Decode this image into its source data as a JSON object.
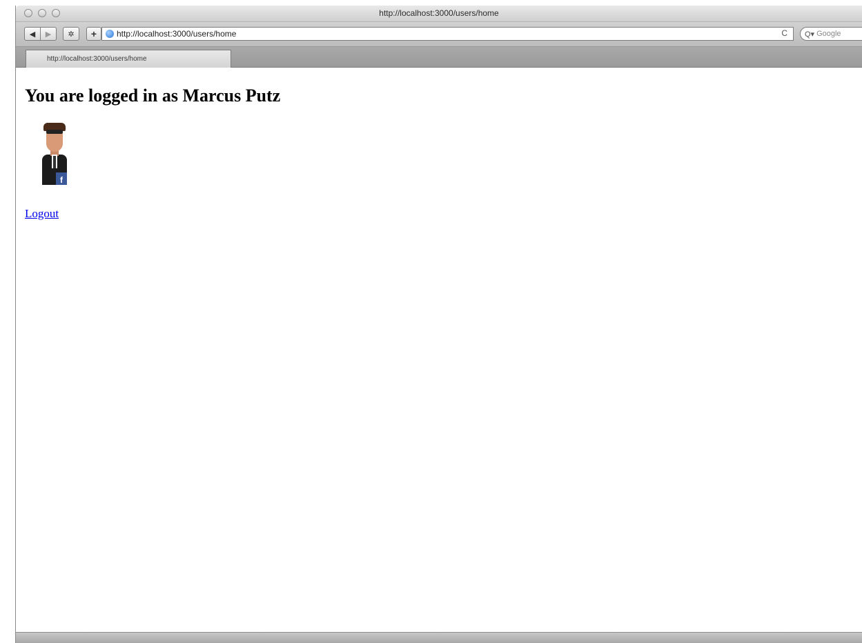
{
  "window": {
    "title": "http://localhost:3000/users/home"
  },
  "toolbar": {
    "back_icon": "◀",
    "forward_icon": "▶",
    "gear_icon": "✲",
    "add_icon": "+",
    "address": "http://localhost:3000/users/home",
    "reload_icon": "C",
    "search_glyph": "Q▾",
    "search_placeholder": "Google"
  },
  "tabs": [
    {
      "label": "http://localhost:3000/users/home"
    }
  ],
  "page": {
    "heading": "You are logged in as Marcus Putz",
    "avatar_badge": "f",
    "logout_label": "Logout"
  },
  "colors": {
    "link": "#0000ee",
    "facebook": "#3b5998"
  }
}
